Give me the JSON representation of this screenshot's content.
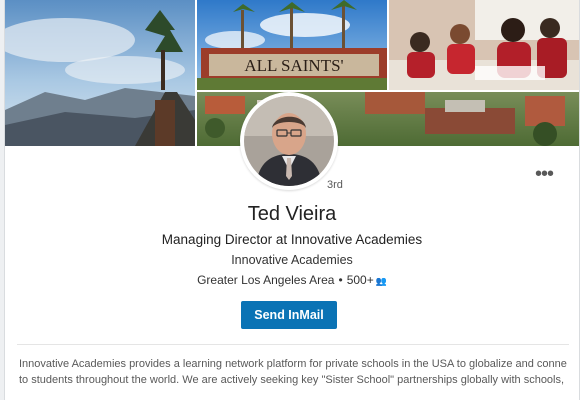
{
  "banner": {
    "sign_text": "ALL SAINTS'"
  },
  "profile": {
    "connection_degree": "3rd",
    "more_label": "•••",
    "name": "Ted Vieira",
    "headline": "Managing Director at Innovative Academies",
    "company": "Innovative Academies",
    "location": "Greater Los Angeles Area",
    "separator": "•",
    "connections": "500+",
    "connections_icon": "people-icon"
  },
  "actions": {
    "send_inmail_label": "Send InMail"
  },
  "summary": {
    "line1": "Innovative Academies provides a learning network platform for private schools in the USA to globalize and connect",
    "line2": "to students throughout the world. We are actively seeking key \"Sister School\" partnerships globally with schools, t..."
  },
  "colors": {
    "button": "#0a73b5",
    "name_text": "#222222"
  }
}
